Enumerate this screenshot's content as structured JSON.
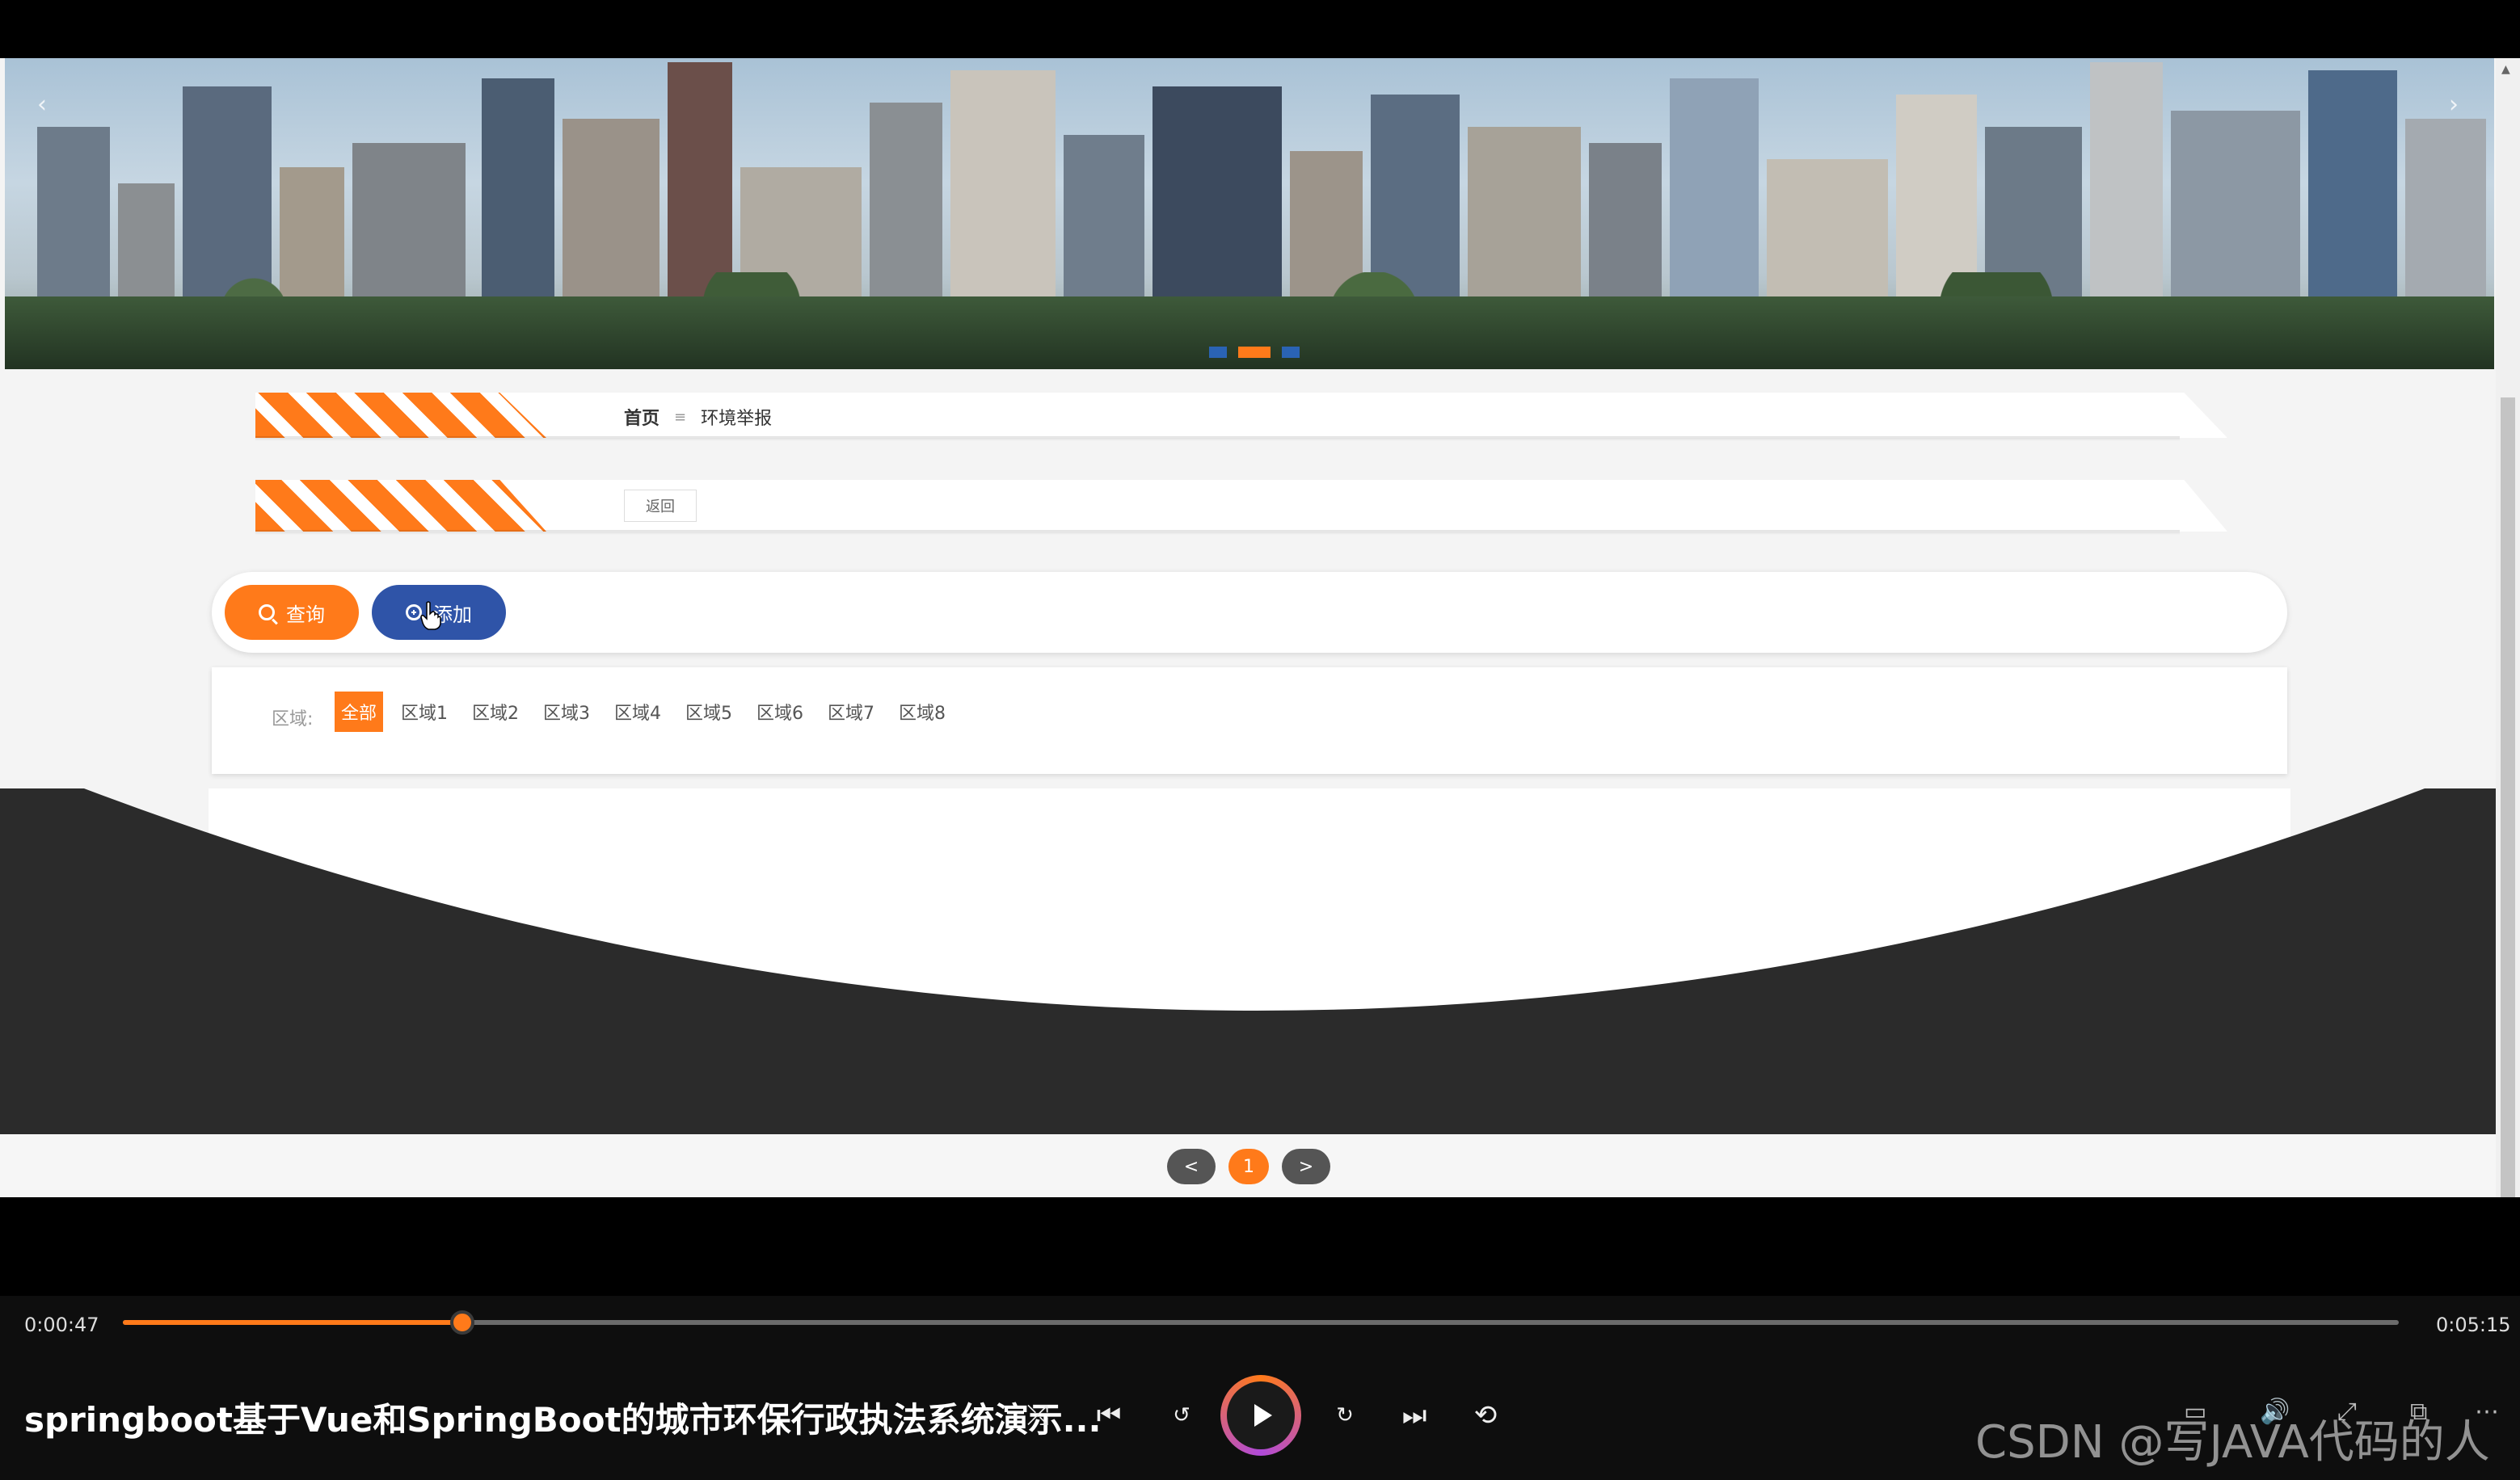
{
  "breadcrumb": {
    "home": "首页",
    "separator": "≡",
    "current": "环境举报"
  },
  "back_button": "返回",
  "toolbar": {
    "search_label": "查询",
    "add_label": "添加"
  },
  "filter": {
    "label": "区域:",
    "items": [
      "全部",
      "区域1",
      "区域2",
      "区域3",
      "区域4",
      "区域5",
      "区域6",
      "区域7",
      "区域8"
    ],
    "selected": "全部"
  },
  "pagination": {
    "prev": "<",
    "current_page": "1",
    "next": ">"
  },
  "banner": {
    "prev_arrow": "‹",
    "next_arrow": "›",
    "slide_count": 3,
    "active_slide": 2
  },
  "player": {
    "current_time": "0:00:47",
    "total_time": "0:05:15",
    "progress": 0.149,
    "title": "springboot基于Vue和SpringBoot的城市环保行政执法系统演示...",
    "icons": [
      "shuffle-icon",
      "previous-icon",
      "rewind-10-icon",
      "play-icon",
      "forward-30-icon",
      "next-icon",
      "repeat-off-icon",
      "subtitles-icon",
      "volume-icon",
      "expand-icon",
      "mini-player-icon",
      "more-icon"
    ]
  },
  "watermark": "CSDN @写JAVA代码的人",
  "colors": {
    "accent": "#ff7a1a",
    "primary": "#2f54a8",
    "dark": "#2b2b2b"
  }
}
